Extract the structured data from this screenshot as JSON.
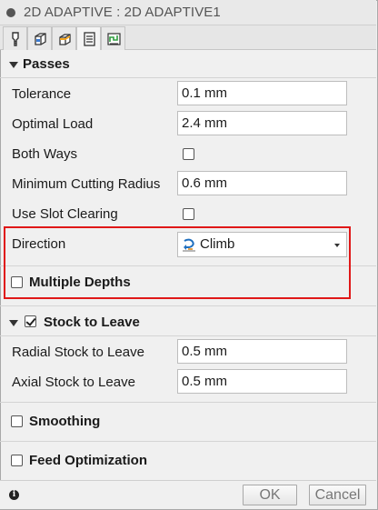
{
  "window": {
    "title": "2D ADAPTIVE : 2D ADAPTIVE1"
  },
  "tabs": [
    {
      "icon": "tool-icon",
      "active": false
    },
    {
      "icon": "geometry-icon",
      "active": false
    },
    {
      "icon": "heights-icon",
      "active": false
    },
    {
      "icon": "passes-icon",
      "active": true
    },
    {
      "icon": "linking-icon",
      "active": false
    }
  ],
  "passes": {
    "heading": "Passes",
    "tolerance_label": "Tolerance",
    "tolerance_value": "0.1 mm",
    "optimal_load_label": "Optimal Load",
    "optimal_load_value": "2.4 mm",
    "both_ways_label": "Both Ways",
    "both_ways_checked": false,
    "min_cutting_radius_label": "Minimum Cutting Radius",
    "min_cutting_radius_value": "0.6 mm",
    "slot_clearing_label": "Use Slot Clearing",
    "slot_clearing_checked": false,
    "direction_label": "Direction",
    "direction_value": "Climb",
    "multiple_depths_label": "Multiple Depths",
    "multiple_depths_checked": false
  },
  "stock": {
    "heading": "Stock to Leave",
    "checked": true,
    "radial_label": "Radial Stock to Leave",
    "radial_value": "0.5 mm",
    "axial_label": "Axial Stock to Leave",
    "axial_value": "0.5 mm"
  },
  "smoothing": {
    "heading": "Smoothing",
    "checked": false
  },
  "feed_optimization": {
    "heading": "Feed Optimization",
    "checked": false
  },
  "footer": {
    "info_icon": "info-icon",
    "ok_label": "OK",
    "cancel_label": "Cancel"
  },
  "colors": {
    "highlight": "#e01818",
    "panel": "#f0f0f0",
    "field_border": "#bdbdbd"
  }
}
